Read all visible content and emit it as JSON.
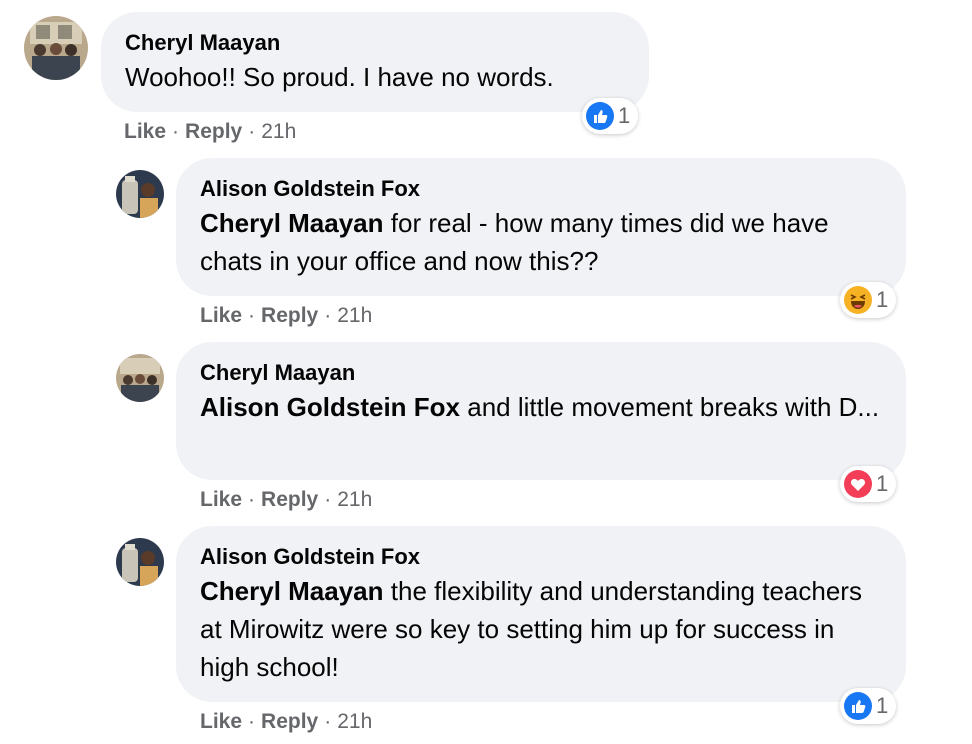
{
  "comments": [
    {
      "author": "Cheryl Maayan",
      "mention": "",
      "text": "Woohoo!! So proud. I have no words.",
      "actions": {
        "like": "Like",
        "reply": "Reply",
        "time": "21h",
        "dot": "·"
      },
      "reaction": {
        "icon": "like-icon",
        "count": "1",
        "color": "#1877f2"
      }
    },
    {
      "author": "Alison Goldstein Fox",
      "mention": "Cheryl Maayan",
      "text": "for real - how many times did we have chats in your office and now this??",
      "actions": {
        "like": "Like",
        "reply": "Reply",
        "time": "21h",
        "dot": "·"
      },
      "reaction": {
        "icon": "haha-icon",
        "count": "1",
        "color": "#f7b125"
      }
    },
    {
      "author": "Cheryl Maayan",
      "mention": "Alison Goldstein Fox",
      "text": "and little movement breaks with D...",
      "actions": {
        "like": "Like",
        "reply": "Reply",
        "time": "21h",
        "dot": "·"
      },
      "reaction": {
        "icon": "love-icon",
        "count": "1",
        "color": "#f33e58"
      }
    },
    {
      "author": "Alison Goldstein Fox",
      "mention": "Cheryl Maayan",
      "text": "the flexibility and understanding teachers at Mirowitz were so key to setting him up for success in high school!",
      "actions": {
        "like": "Like",
        "reply": "Reply",
        "time": "21h",
        "dot": "·"
      },
      "reaction": {
        "icon": "like-icon",
        "count": "1",
        "color": "#1877f2"
      }
    }
  ]
}
